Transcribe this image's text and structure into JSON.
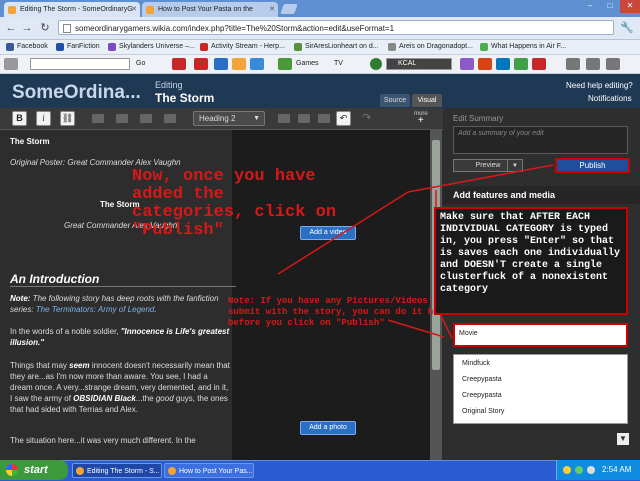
{
  "browser": {
    "tabs": [
      {
        "title": "Editing The Storm - SomeOrdinaryG",
        "active": true
      },
      {
        "title": "How to Post Your Pasta on the",
        "active": false
      }
    ],
    "window_controls": {
      "minimize": "–",
      "maximize": "□",
      "close": "✕"
    },
    "url": "someordinarygamers.wikia.com/index.php?title=The%20Storm&action=edit&useFormat=1",
    "bookmarks": [
      {
        "label": "Facebook",
        "color": "#3b5998"
      },
      {
        "label": "FanFiction",
        "color": "#1f4fa8"
      },
      {
        "label": "Skylanders Universe –...",
        "color": "#7a4bc2"
      },
      {
        "label": "Activity Stream - Herp...",
        "color": "#c62828"
      },
      {
        "label": "SirAresLionheart on d...",
        "color": "#5a8f3c"
      },
      {
        "label": "Areis on Dragonadopt...",
        "color": "#888888"
      },
      {
        "label": "What Happens in Air F...",
        "color": "#4caf50"
      }
    ],
    "toolbar": {
      "go_label": "Go",
      "games_label": "Games",
      "tv_label": "TV",
      "radio_label": "KCAL"
    }
  },
  "wiki": {
    "site_name": "SomeOrdina...",
    "editing_label": "Editing",
    "page_title": "The Storm",
    "help_link": "Need help editing?",
    "notifications_link": "Notifications",
    "source_tab": "Source",
    "visual_tab": "Visual"
  },
  "editor_toolbar": {
    "bold": "B",
    "italic": "i",
    "heading_select": "Heading 2",
    "more_label": "more"
  },
  "content": {
    "title": "The Storm",
    "original_poster": "Original Poster: Great Commander Alex Vaughn",
    "center_title": "The Storm",
    "center_author": "Great Commander Alex Vaughn",
    "add_video": "Add a video",
    "intro_heading": "An Introduction",
    "note_label": "Note:",
    "note_text": " The following story has deep roots with the fanfiction series: ",
    "note_link": "The Terminators: Army of Legend",
    "note_end": ".",
    "soldier_text": "In the words of a noble soldier, ",
    "soldier_quote": "\"Innocence is Life's greatest illusion.\"",
    "para_part1": "Things that may ",
    "para_seem": "seem",
    "para_part2": " innocent doesn't necessarily mean that they are...as I'm now more than aware. You see, I had a dream once. A very...strange dream, very demented, and in it, I saw the army of ",
    "para_obsidian": "OBSIDIAN Black",
    "para_part3": "...the ",
    "para_good": "good",
    "para_part4": " guys, the ones that had sided with Terrias and Alex.",
    "situation_text": "The situation here...it was very much different. In the",
    "add_photo": "Add a photo"
  },
  "right_panel": {
    "summary_header": "Edit Summary",
    "summary_placeholder": "Add a summary of your edit",
    "preview": "Preview",
    "publish": "Publish",
    "features_header": "Add features and media",
    "category_value": "Movie",
    "categories": [
      "Mindfuck",
      "Creepypasta",
      "Creepypasta",
      "Original Story"
    ]
  },
  "annotations": {
    "main": "Now, once you have added the categories, click on \"Publish\"",
    "note": "Note: If you have any Pictures/Videos to submit with the story, you can do it here before you click on \"Publish\"",
    "box": "Make sure that AFTER EACH INDIVIDUAL CATEGORY is typed in, you press \"Enter\" so that is saves each one individually and DOESN'T create a single clusterfuck of a nonexistent category"
  },
  "taskbar": {
    "start": "start",
    "items": [
      {
        "label": "Editing The Storm - S..."
      },
      {
        "label": "How to Post Your Pas..."
      }
    ],
    "clock": "2:54 AM"
  }
}
